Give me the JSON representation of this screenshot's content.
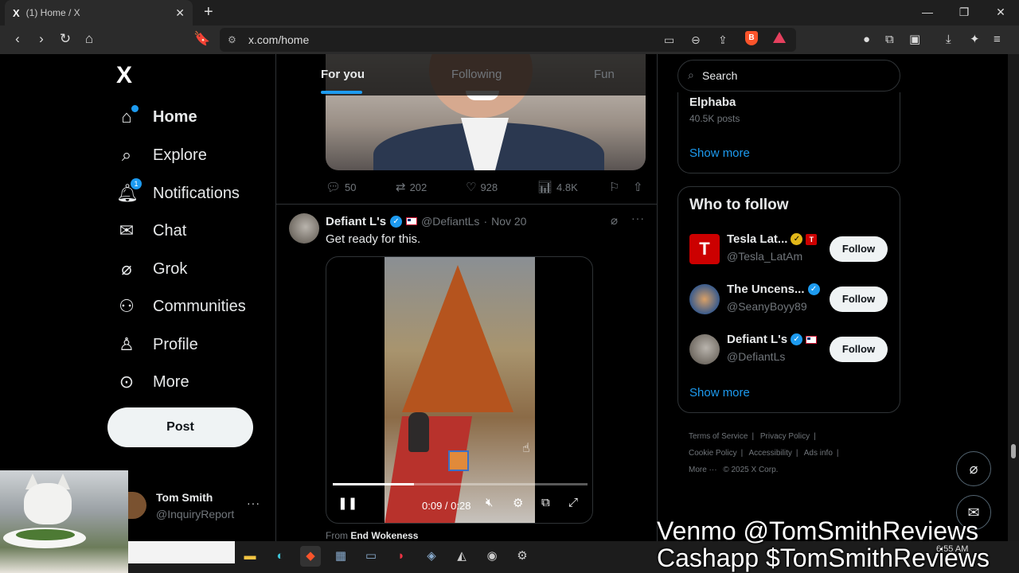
{
  "browser": {
    "tab_title": "(1) Home / X",
    "tab_icon": "X",
    "url": "x.com/home",
    "new_tab": "+",
    "close_tab": "✕"
  },
  "sidebar": {
    "logo": "X",
    "items": [
      {
        "label": "Home",
        "icon": "home-icon"
      },
      {
        "label": "Explore",
        "icon": "search-icon"
      },
      {
        "label": "Notifications",
        "icon": "bell-icon",
        "badge": "1"
      },
      {
        "label": "Chat",
        "icon": "mail-icon"
      },
      {
        "label": "Grok",
        "icon": "grok-icon"
      },
      {
        "label": "Communities",
        "icon": "communities-icon"
      },
      {
        "label": "Profile",
        "icon": "person-icon"
      },
      {
        "label": "More",
        "icon": "more-circle-icon"
      }
    ],
    "post_label": "Post",
    "account": {
      "name": "Tom Smith",
      "handle": "@InquiryReport"
    }
  },
  "feed": {
    "tabs": [
      "For you",
      "Following",
      "Fun"
    ],
    "active_tab": "For you",
    "prev_tweet_actions": {
      "replies": "50",
      "reposts": "202",
      "likes": "928",
      "views": "4.8K"
    },
    "tweet": {
      "name": "Defiant L's",
      "handle": "@DefiantLs",
      "sep": "·",
      "date": "Nov 20",
      "text": "Get ready for this.",
      "video": {
        "time": "0:09 / 0:28",
        "progress": 0.32
      },
      "from_prefix": "From",
      "from_name": "End Wokeness"
    }
  },
  "right": {
    "search_placeholder": "Search",
    "trend": {
      "name": "Elphaba",
      "posts": "40.5K posts"
    },
    "show_more": "Show more",
    "who_to_follow": {
      "title": "Who to follow",
      "items": [
        {
          "name": "Tesla Lat...",
          "handle": "@Tesla_LatAm",
          "button": "Follow"
        },
        {
          "name": "The Uncens...",
          "handle": "@SeanyBoyy89",
          "button": "Follow"
        },
        {
          "name": "Defiant L's",
          "handle": "@DefiantLs",
          "button": "Follow"
        }
      ]
    },
    "footer": [
      "Terms of Service",
      "Privacy Policy",
      "Cookie Policy",
      "Accessibility",
      "Ads info",
      "More ···",
      "© 2025 X Corp."
    ]
  },
  "taskbar": {
    "time": "6:55 AM"
  },
  "overlay": {
    "line1": "Venmo @TomSmithReviews",
    "line2": "Cashapp $TomSmithReviews"
  },
  "colors": {
    "accent": "#1d9bf0",
    "background": "#000000",
    "muted": "#71767b"
  }
}
